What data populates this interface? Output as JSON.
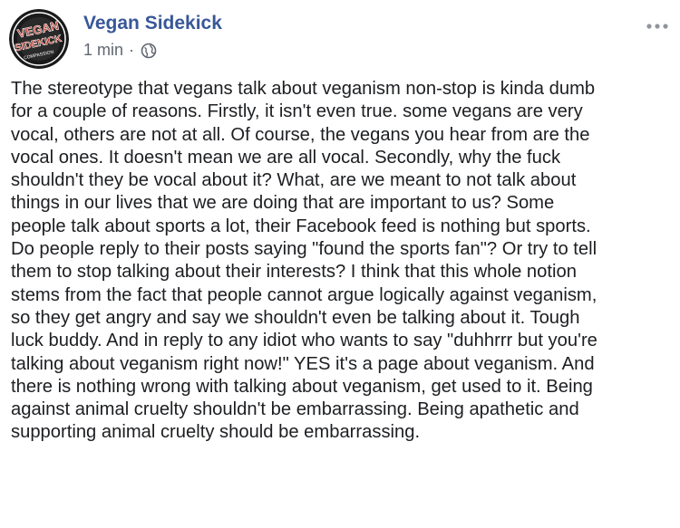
{
  "post": {
    "author": "Vegan Sidekick",
    "timestamp": "1 min",
    "separator": "·",
    "avatar": {
      "text_lines": [
        "VEGAN",
        "SIDEKICK",
        "COMPASSION"
      ]
    },
    "privacy_icon": "globe-icon",
    "options_icon": "more-options-icon",
    "colors": {
      "author": "#385898",
      "meta": "#616770",
      "text": "#1c1e21",
      "avatar_bg": "#1a1a1a",
      "avatar_accent": "#c0392b"
    },
    "body_lines": [
      "The stereotype that vegans talk about veganism non-stop is kinda dumb",
      "for a couple of reasons. Firstly, it isn't even true. some vegans are very",
      "vocal, others are not at all. Of course, the vegans you hear from are the",
      "vocal ones. It doesn't mean we are all vocal. Secondly, why the fuck",
      "shouldn't they be vocal about it? What, are we meant to not talk about",
      "things in our lives that we are doing that are important to us? Some",
      "people talk about sports a lot, their Facebook feed is nothing but sports.",
      "Do people reply to their posts saying \"found the sports fan\"? Or try to tell",
      "them to stop talking about their interests? I think that this whole notion",
      "stems from the fact that people cannot argue logically against veganism,",
      "so they get angry and say we shouldn't even be talking about it. Tough",
      "luck buddy. And in reply to any idiot who wants to say \"duhhrrr but you're",
      "talking about veganism right now!\" YES it's a page about veganism. And",
      "there is nothing wrong with talking about veganism, get used to it. Being",
      "against animal cruelty shouldn't be embarrassing. Being apathetic and",
      "supporting animal cruelty should be embarrassing."
    ]
  }
}
